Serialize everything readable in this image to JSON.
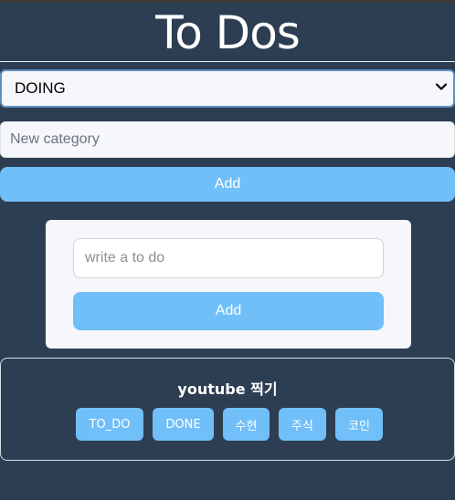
{
  "app": {
    "title": "To Dos"
  },
  "category_select": {
    "selected": "DOING"
  },
  "new_category": {
    "placeholder": "New category",
    "button_label": "Add"
  },
  "todo_form": {
    "placeholder": "write a to do",
    "button_label": "Add"
  },
  "todo_item": {
    "text": "youtube 찍기",
    "actions": [
      "TO_DO",
      "DONE",
      "수현",
      "주식",
      "코인"
    ]
  },
  "colors": {
    "background": "#2d3e52",
    "accent": "#71bff8",
    "card": "#f5f7fa"
  }
}
